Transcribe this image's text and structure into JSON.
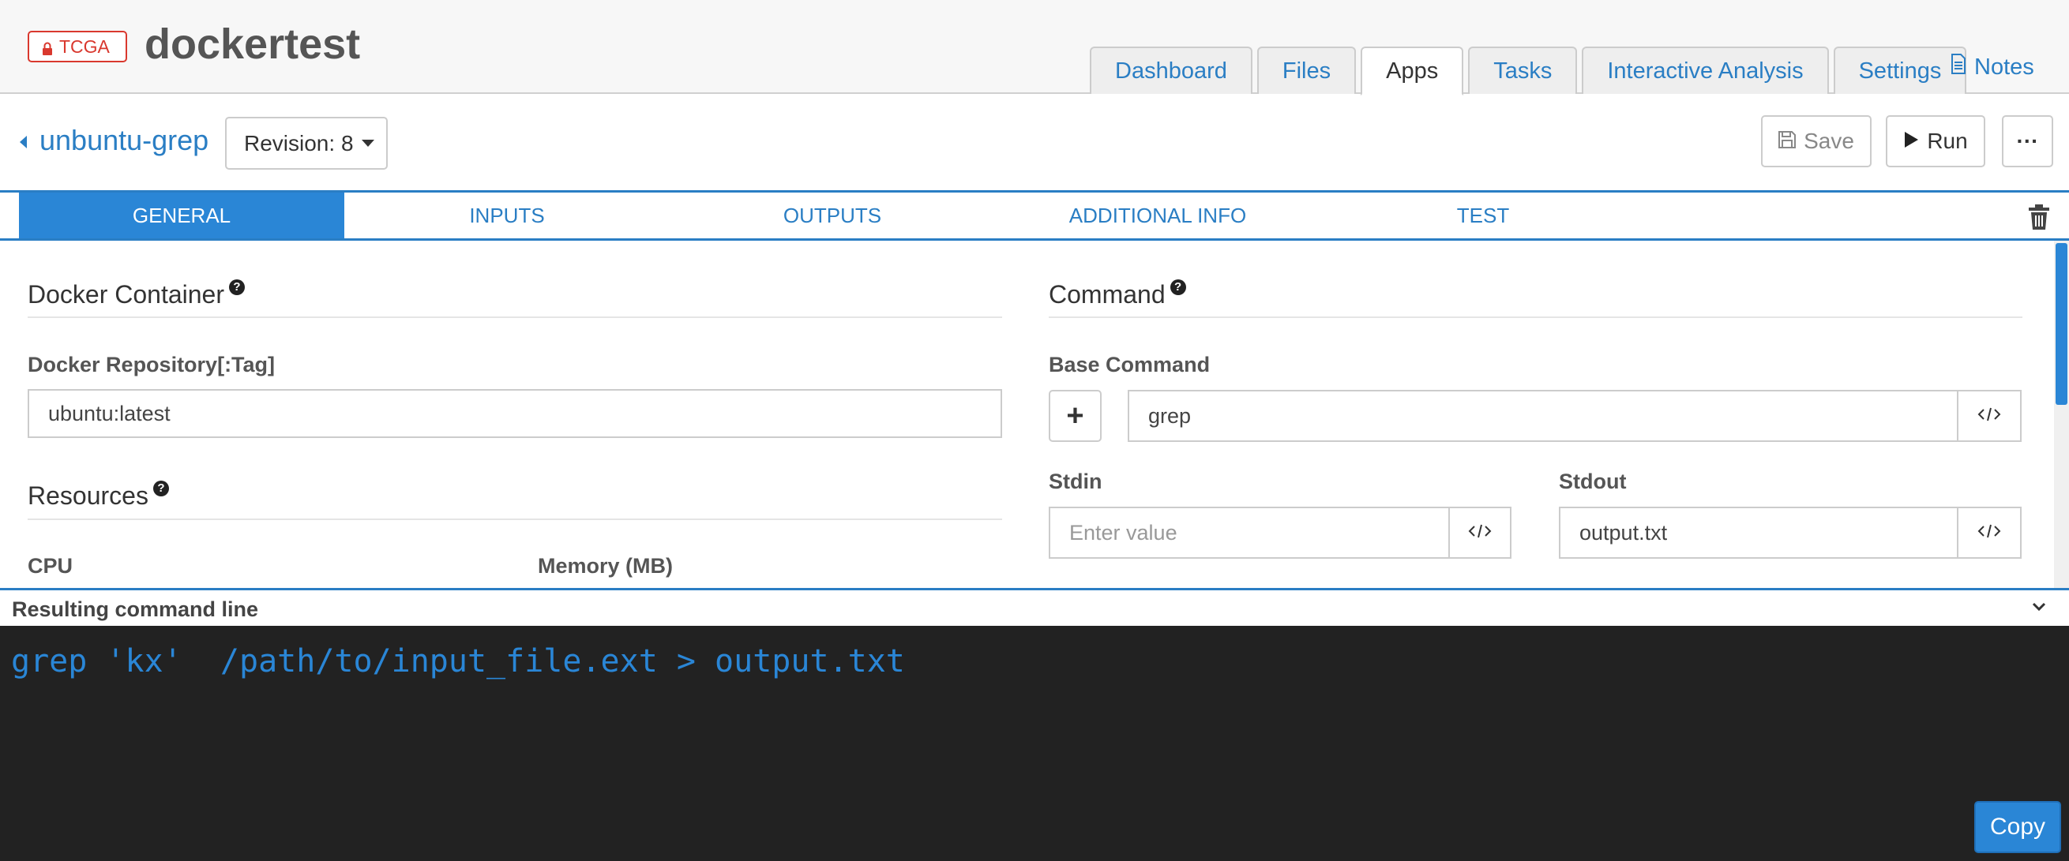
{
  "header": {
    "badge_label": "TCGA",
    "project_title": "dockertest",
    "tabs": [
      {
        "label": "Dashboard"
      },
      {
        "label": "Files"
      },
      {
        "label": "Apps"
      },
      {
        "label": "Tasks"
      },
      {
        "label": "Interactive Analysis"
      },
      {
        "label": "Settings"
      }
    ],
    "active_tab": "Apps",
    "notes_label": "Notes"
  },
  "appbar": {
    "app_name": "unbuntu-grep",
    "revision_label": "Revision: 8",
    "save_label": "Save",
    "run_label": "Run",
    "more_label": "···"
  },
  "subtabs": [
    {
      "label": "GENERAL"
    },
    {
      "label": "INPUTS"
    },
    {
      "label": "OUTPUTS"
    },
    {
      "label": "ADDITIONAL INFO"
    },
    {
      "label": "TEST"
    }
  ],
  "general": {
    "docker": {
      "title": "Docker Container",
      "repo_label": "Docker Repository[:Tag]",
      "repo_value": "ubuntu:latest"
    },
    "resources": {
      "title": "Resources",
      "cpu_label": "CPU",
      "memory_label": "Memory (MB)"
    },
    "command": {
      "title": "Command",
      "base_command_label": "Base Command",
      "base_command_value": "grep",
      "stdin_label": "Stdin",
      "stdin_placeholder": "Enter value",
      "stdout_label": "Stdout",
      "stdout_value": "output.txt"
    }
  },
  "command_line": {
    "header_label": "Resulting command line",
    "text": "grep 'kx'  /path/to/input_file.ext > output.txt",
    "copy_label": "Copy"
  },
  "colors": {
    "accent": "#2a86d6",
    "link": "#2a7ec4",
    "badge": "#d9382e",
    "terminal_bg": "#222222"
  }
}
